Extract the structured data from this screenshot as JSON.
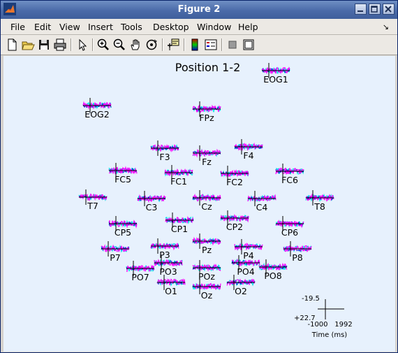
{
  "window": {
    "title": "Figure 2",
    "controls": [
      "minimize",
      "maximize",
      "close"
    ]
  },
  "menubar": {
    "items": [
      {
        "label": "File"
      },
      {
        "label": "Edit"
      },
      {
        "label": "View"
      },
      {
        "label": "Insert"
      },
      {
        "label": "Tools"
      },
      {
        "label": "Desktop"
      },
      {
        "label": "Window"
      },
      {
        "label": "Help"
      }
    ]
  },
  "toolbar": {
    "buttons": [
      "new-figure-icon",
      "open-file-icon",
      "save-icon",
      "print-icon",
      "edit-plot-arrow-icon",
      "zoom-in-icon",
      "zoom-out-icon",
      "pan-hand-icon",
      "rotate-3d-icon",
      "data-cursor-icon",
      "colorbar-icon",
      "legend-icon",
      "hide-plot-tools-icon",
      "show-plot-tools-icon"
    ]
  },
  "figure": {
    "title": "Position 1-2",
    "channels": [
      {
        "label": "EOG1"
      },
      {
        "label": "EOG2"
      },
      {
        "label": "FPz"
      },
      {
        "label": "F3"
      },
      {
        "label": "Fz"
      },
      {
        "label": "F4"
      },
      {
        "label": "FC5"
      },
      {
        "label": "FC1"
      },
      {
        "label": "FC2"
      },
      {
        "label": "FC6"
      },
      {
        "label": "T7"
      },
      {
        "label": "C3"
      },
      {
        "label": "Cz"
      },
      {
        "label": "C4"
      },
      {
        "label": "T8"
      },
      {
        "label": "CP5"
      },
      {
        "label": "CP1"
      },
      {
        "label": "CP2"
      },
      {
        "label": "CP6"
      },
      {
        "label": "P7"
      },
      {
        "label": "P3"
      },
      {
        "label": "Pz"
      },
      {
        "label": "P4"
      },
      {
        "label": "P8"
      },
      {
        "label": "PO7"
      },
      {
        "label": "PO3"
      },
      {
        "label": "POz"
      },
      {
        "label": "PO4"
      },
      {
        "label": "PO8"
      },
      {
        "label": "O1"
      },
      {
        "label": "Oz"
      },
      {
        "label": "O2"
      }
    ],
    "scale": {
      "y_top": "-19.5",
      "y_bottom": "+22.7",
      "x_left": "-1000",
      "x_right": "1992",
      "x_label": "Time (ms)"
    },
    "colors": {
      "trace_primary": "#ff00ff",
      "trace_secondary": "#00e5e5",
      "trace_tertiary": "#0000cc",
      "background": "#e7f1fd"
    }
  }
}
